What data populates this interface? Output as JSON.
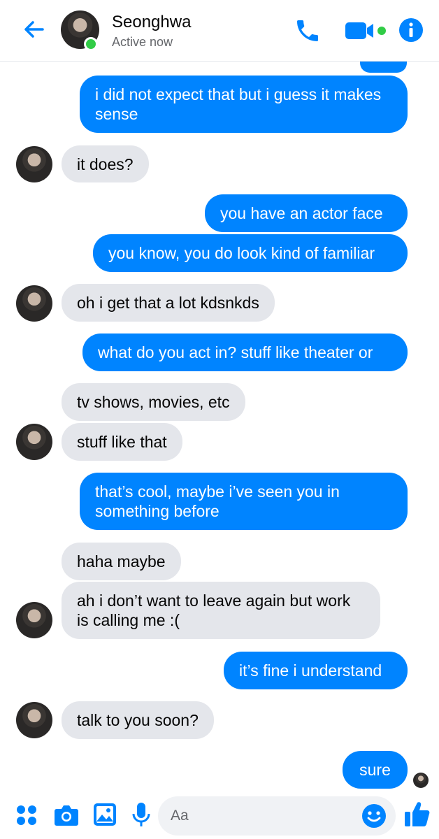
{
  "header": {
    "contact_name": "Seonghwa",
    "status": "Active now",
    "accent_color": "#0084ff",
    "active_color": "#31cc46"
  },
  "messages": [
    {
      "side": "out",
      "text": "i did not expect that but i guess it makes sense"
    },
    {
      "side": "in",
      "text": "it does?"
    },
    {
      "side": "out",
      "text": "you have an actor face"
    },
    {
      "side": "out",
      "text": "you know, you do look kind of familiar"
    },
    {
      "side": "in",
      "text": "oh i get that a lot kdsnkds"
    },
    {
      "side": "out",
      "text": "what do you act in? stuff like theater or"
    },
    {
      "side": "in",
      "text": "tv shows, movies, etc"
    },
    {
      "side": "in",
      "text": "stuff like that"
    },
    {
      "side": "out",
      "text": "that’s cool, maybe i’ve seen you in something before"
    },
    {
      "side": "in",
      "text": "haha maybe"
    },
    {
      "side": "in",
      "text": "ah i don’t want to leave again but work is calling me :("
    },
    {
      "side": "out",
      "text": "it’s fine i understand"
    },
    {
      "side": "in",
      "text": "talk to you soon?"
    },
    {
      "side": "out",
      "text": "sure"
    }
  ],
  "composer": {
    "placeholder": "Aa"
  },
  "icons": {
    "header": [
      "back-arrow-icon",
      "phone-icon",
      "video-camera-icon",
      "info-icon"
    ],
    "bottom": [
      "more-apps-icon",
      "camera-icon",
      "gallery-icon",
      "microphone-icon",
      "emoji-icon",
      "thumbs-up-icon"
    ]
  }
}
